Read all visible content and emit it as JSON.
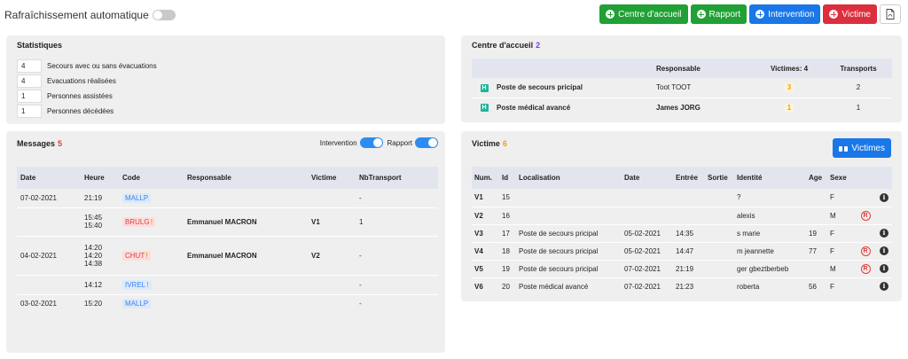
{
  "header": {
    "auto_refresh_label": "Rafraîchissement automatique",
    "buttons": {
      "centre": "Centre d'accueil",
      "rapport": "Rapport",
      "intervention": "Intervention",
      "victime": "Victime"
    }
  },
  "stats": {
    "title": "Statistiques",
    "rows": [
      {
        "value": "4",
        "label": "Secours avec ou sans évacuations"
      },
      {
        "value": "4",
        "label": "Evacuations réalisées"
      },
      {
        "value": "1",
        "label": "Personnes assistées"
      },
      {
        "value": "1",
        "label": "Personnes décédées"
      }
    ]
  },
  "centre": {
    "title": "Centre d'accueil",
    "count": "2",
    "headers": {
      "responsable": "Responsable",
      "victimes": "Victimes: 4",
      "transports": "Transports"
    },
    "rows": [
      {
        "name": "Poste de secours pricipal",
        "responsable": "Toot TOOT",
        "victimes": "3",
        "transports": "2"
      },
      {
        "name": "Poste médical avancé",
        "responsable": "James JORG",
        "victimes": "1",
        "transports": "1"
      }
    ]
  },
  "messages": {
    "title": "Messages",
    "count": "5",
    "switch_intervention": "Intervention",
    "switch_rapport": "Rapport",
    "headers": {
      "date": "Date",
      "heure": "Heure",
      "code": "Code",
      "responsable": "Responsable",
      "victime": "Victime",
      "nbtransport": "NbTransport"
    },
    "rows": [
      {
        "date": "07-02-2021",
        "heure": [
          "21:19"
        ],
        "code": "MALLP",
        "code_color": "blue",
        "warn": false,
        "responsable": "",
        "victime": "",
        "nb": "-"
      },
      {
        "date": "",
        "heure": [
          "15:45",
          "15:40"
        ],
        "code": "BRULG",
        "code_color": "red",
        "warn": true,
        "responsable": "Emmanuel MACRON",
        "victime": "V1",
        "nb": "1"
      },
      {
        "date": "04-02-2021",
        "heure": [
          "14:20",
          "14:20",
          "14:38"
        ],
        "code": "CHUT",
        "code_color": "red",
        "warn": true,
        "responsable": "Emmanuel MACRON",
        "victime": "V2",
        "nb": "-"
      },
      {
        "date": "",
        "heure": [
          "14:12"
        ],
        "code": "IVREL",
        "code_color": "blue",
        "warn": true,
        "responsable": "",
        "victime": "",
        "nb": "-"
      },
      {
        "date": "03-02-2021",
        "heure": [
          "15:20"
        ],
        "code": "MALLP",
        "code_color": "blue",
        "warn": false,
        "responsable": "",
        "victime": "",
        "nb": "-"
      }
    ]
  },
  "victime": {
    "title": "Victime",
    "count": "6",
    "button": "Victimes",
    "headers": {
      "num": "Num.",
      "id": "Id",
      "localisation": "Localisation",
      "date": "Date",
      "entree": "Entrée",
      "sortie": "Sortie",
      "identite": "Identité",
      "age": "Age",
      "sexe": "Sexe"
    },
    "rows": [
      {
        "num": "V1",
        "id": "15",
        "loc": "",
        "date": "",
        "entree": "",
        "sortie": "",
        "identite": "?",
        "age": "",
        "sexe": "F",
        "r": false,
        "info": true
      },
      {
        "num": "V2",
        "id": "16",
        "loc": "",
        "date": "",
        "entree": "",
        "sortie": "",
        "identite": "alexis",
        "age": "",
        "sexe": "M",
        "r": true,
        "info": false
      },
      {
        "num": "V3",
        "id": "17",
        "loc": "Poste de secours pricipal",
        "date": "05-02-2021",
        "entree": "14:35",
        "sortie": "",
        "identite": "s marie",
        "age": "19",
        "sexe": "F",
        "r": false,
        "info": true
      },
      {
        "num": "V4",
        "id": "18",
        "loc": "Poste de secours pricipal",
        "date": "05-02-2021",
        "entree": "14:47",
        "sortie": "",
        "identite": "m jeannette",
        "age": "77",
        "sexe": "F",
        "r": true,
        "info": true
      },
      {
        "num": "V5",
        "id": "19",
        "loc": "Poste de secours pricipal",
        "date": "07-02-2021",
        "entree": "21:19",
        "sortie": "",
        "identite": "ger gbeztberbeb",
        "age": "",
        "sexe": "M",
        "r": true,
        "info": true
      },
      {
        "num": "V6",
        "id": "20",
        "loc": "Poste médical avancé",
        "date": "07-02-2021",
        "entree": "21:23",
        "sortie": "",
        "identite": "roberta",
        "age": "56",
        "sexe": "F",
        "r": false,
        "info": true
      }
    ]
  }
}
